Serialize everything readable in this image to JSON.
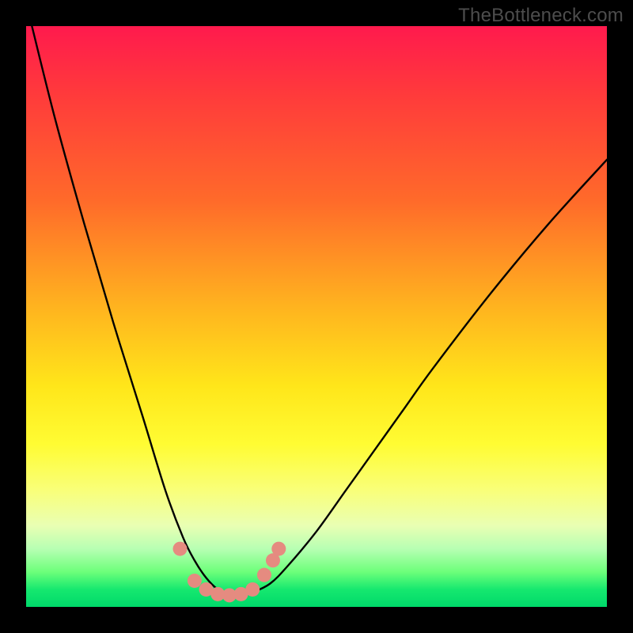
{
  "watermark": "TheBottleneck.com",
  "colors": {
    "frame": "#000000",
    "curve_stroke": "#000000",
    "marker_fill": "#e58b80",
    "watermark_text": "#4d4d4d"
  },
  "chart_data": {
    "type": "line",
    "title": "",
    "xlabel": "",
    "ylabel": "",
    "xlim": [
      0,
      100
    ],
    "ylim": [
      0,
      100
    ],
    "grid": false,
    "legend": false,
    "series": [
      {
        "name": "bottleneck-curve",
        "x": [
          1,
          5,
          10,
          15,
          20,
          24,
          27,
          29,
          31,
          33,
          35,
          37,
          39,
          42,
          45,
          50,
          55,
          60,
          65,
          70,
          80,
          90,
          100
        ],
        "y": [
          100,
          84,
          66,
          49,
          33,
          20,
          12,
          8,
          5,
          3,
          2,
          2,
          2.5,
          4,
          7,
          13,
          20,
          27,
          34,
          41,
          54,
          66,
          77
        ]
      }
    ],
    "markers": [
      {
        "x": 26.5,
        "y": 10
      },
      {
        "x": 29,
        "y": 4.5
      },
      {
        "x": 31,
        "y": 3
      },
      {
        "x": 33,
        "y": 2.2
      },
      {
        "x": 35,
        "y": 2
      },
      {
        "x": 37,
        "y": 2.2
      },
      {
        "x": 39,
        "y": 3
      },
      {
        "x": 41,
        "y": 5.5
      },
      {
        "x": 42.5,
        "y": 8
      },
      {
        "x": 43.5,
        "y": 10
      }
    ]
  }
}
